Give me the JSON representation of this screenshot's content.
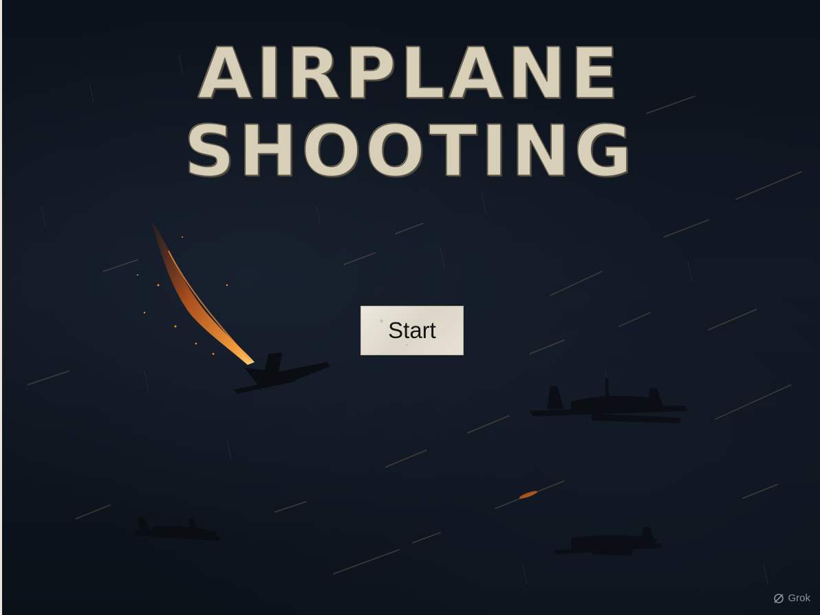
{
  "title": {
    "line1": "AIRPLANE",
    "line2": "SHOOTING"
  },
  "menu": {
    "start_label": "Start"
  },
  "watermark": {
    "label": "Grok",
    "icon": "grok-logo-icon"
  },
  "colors": {
    "background": "#0b111a",
    "title_text": "#d8cfb9",
    "button_face": "#e2ddd0",
    "fire": "#e0792a",
    "tracer": "#c98a4e"
  },
  "scene": {
    "planes": [
      "burning-plane",
      "enemy-plane",
      "enemy-plane",
      "enemy-plane"
    ],
    "icons": [
      "fire-trail-icon",
      "plane-icon"
    ]
  }
}
